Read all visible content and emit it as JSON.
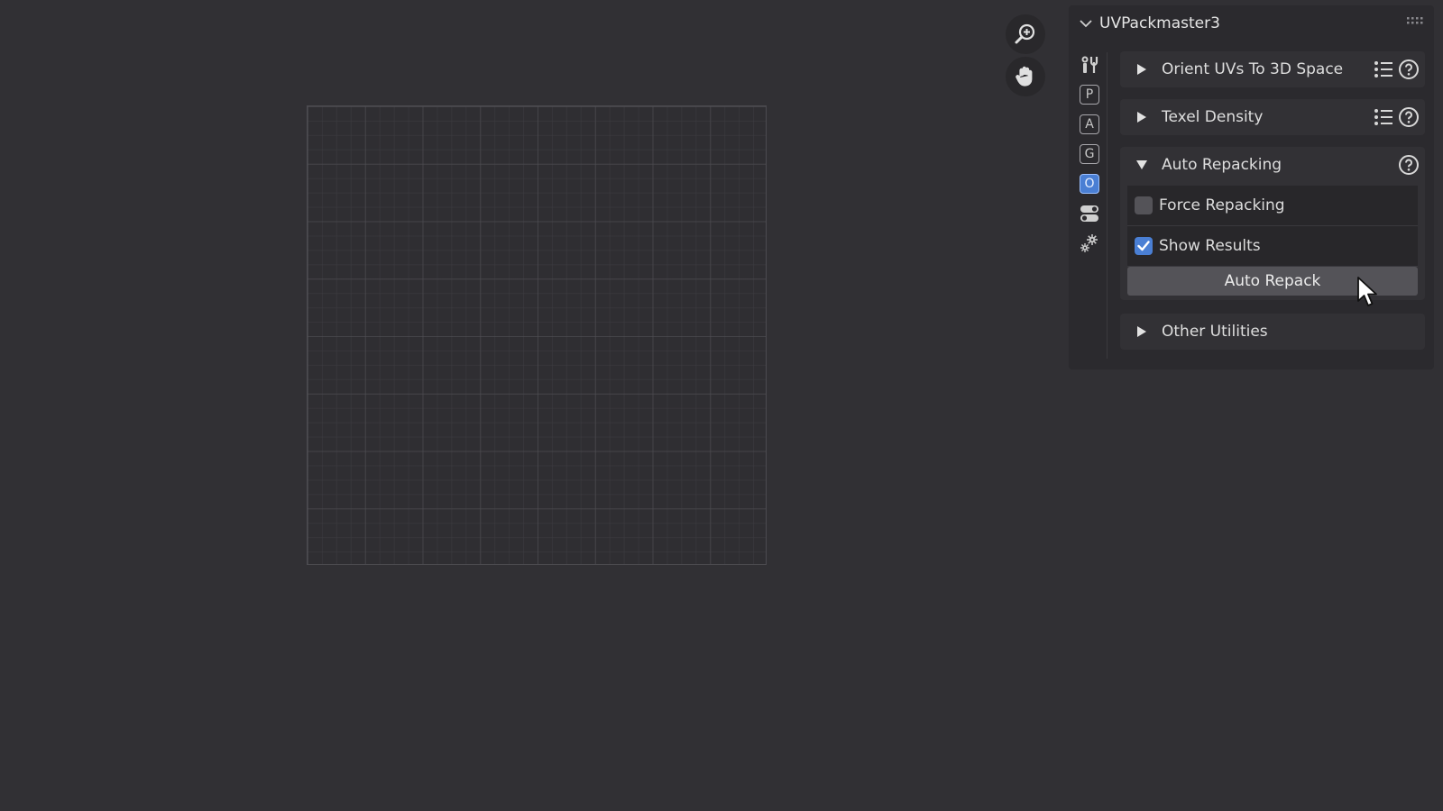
{
  "panel": {
    "title": "UVPackmaster3",
    "tabs": [
      {
        "name": "tools",
        "icon": "tools-icon"
      },
      {
        "name": "P",
        "label": "P"
      },
      {
        "name": "A",
        "label": "A"
      },
      {
        "name": "G",
        "label": "G"
      },
      {
        "name": "O",
        "label": "O",
        "active": true
      },
      {
        "name": "toggles",
        "icon": "toggles-icon"
      },
      {
        "name": "settings",
        "icon": "gear-icon"
      }
    ],
    "subpanels": [
      {
        "label": "Orient UVs To 3D Space",
        "expanded": false
      },
      {
        "label": "Texel Density",
        "expanded": false
      },
      {
        "label": "Auto Repacking",
        "expanded": true,
        "options": [
          {
            "label": "Force Repacking",
            "checked": false
          },
          {
            "label": "Show Results",
            "checked": true
          }
        ],
        "button_label": "Auto Repack"
      },
      {
        "label": "Other Utilities",
        "expanded": false
      }
    ]
  },
  "viewport": {
    "tools": [
      "zoom-icon",
      "pan-hand-icon"
    ]
  },
  "colors": {
    "background": "#313034",
    "panel": "#2b2a2e",
    "subpanel": "#323135",
    "accent": "#4a7fd4"
  }
}
